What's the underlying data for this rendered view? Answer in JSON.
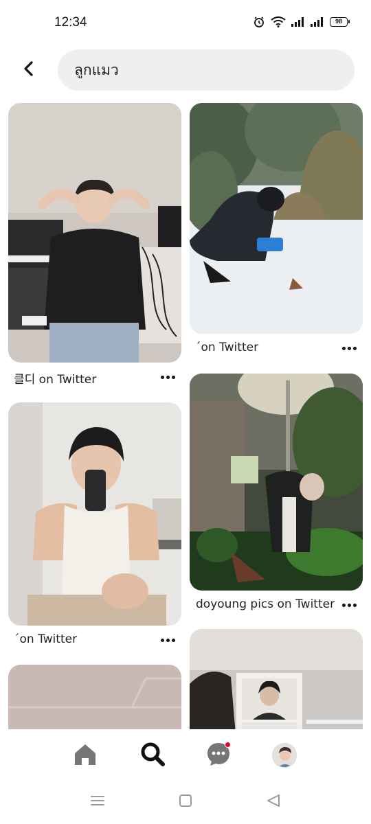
{
  "status_bar": {
    "time": "12:34",
    "battery": "98",
    "icons": [
      "alarm-icon",
      "wifi-icon",
      "signal-icon",
      "signal-icon",
      "battery-icon"
    ]
  },
  "header": {
    "back_icon": "chevron-left-icon",
    "search_query": "ลูกแมว"
  },
  "pins": [
    {
      "caption": "클디 on Twitter",
      "more_icon": "more-horizontal-icon"
    },
    {
      "caption": "ˊon Twitter",
      "more_icon": "more-horizontal-icon"
    },
    {
      "caption": "ˊon Twitter",
      "more_icon": "more-horizontal-icon"
    },
    {
      "caption": "doyoung pics on Twitter",
      "more_icon": "more-horizontal-icon"
    }
  ],
  "bottom_nav": {
    "items": [
      "home-icon",
      "search-icon",
      "chat-icon",
      "profile-avatar"
    ],
    "active": "search-icon",
    "notification_color": "#e60023"
  },
  "system_nav": [
    "menu-icon",
    "home-square-icon",
    "back-triangle-icon"
  ],
  "colors": {
    "accent": "#e60023",
    "search_bg": "#efefef",
    "text": "#111111"
  }
}
